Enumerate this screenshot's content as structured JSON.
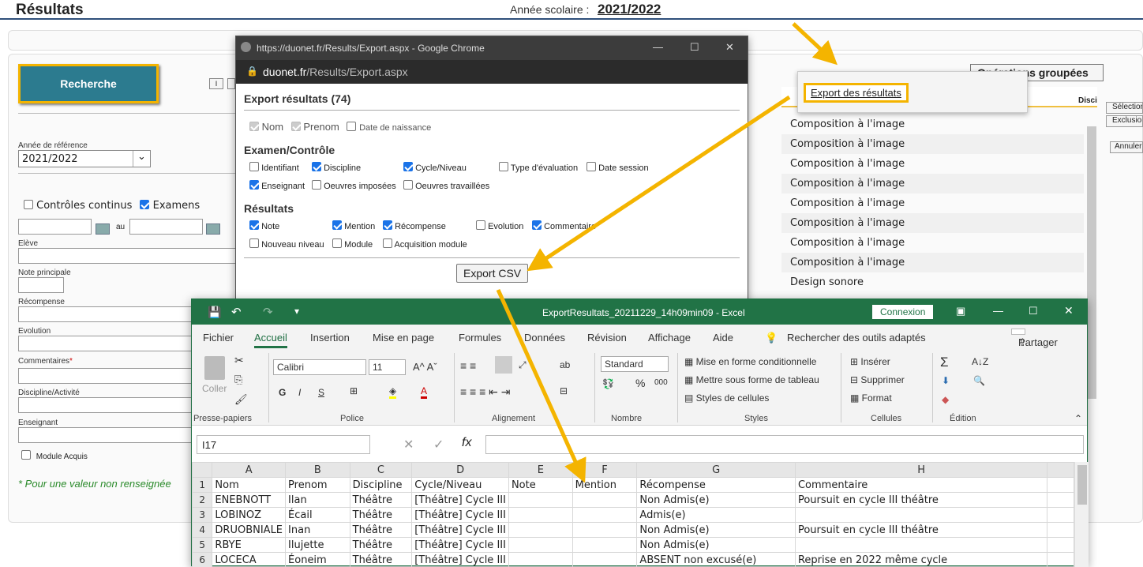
{
  "page": {
    "title": "Résultats",
    "year_label": "Année scolaire :",
    "year_value": "2021/2022"
  },
  "search": {
    "button": "Recherche",
    "ref_year_label": "Année de référence",
    "ref_year_value": "2021/2022",
    "controles_label": "Contrôles continus",
    "examens_label": "Examens",
    "au_label": "au",
    "eleve_label": "Elève",
    "note_label": "Note principale",
    "recompense_label": "Récompense",
    "evolution_label": "Evolution",
    "commentaires_label": "Commentaires",
    "commentaires_star": "*",
    "discipline_label": "Discipline/Activité",
    "enseignant_label": "Enseignant",
    "module_label": "Module Acquis",
    "footnote": "* Pour une valeur non renseignée"
  },
  "ops": {
    "grouped_label": "Opérations groupées",
    "export_link": "Export des résultats",
    "selection": "Sélection",
    "exclusion": "Exclusion",
    "annuler": "Annuler",
    "col_disc": "Disci"
  },
  "results_rows": [
    "Composition à l'image",
    "Composition à l'image",
    "Composition à l'image",
    "Composition à l'image",
    "Composition à l'image",
    "Composition à l'image",
    "Composition à l'image",
    "Composition à l'image",
    "Design sonore"
  ],
  "chrome": {
    "title": "https://duonet.fr/Results/Export.aspx - Google Chrome",
    "domain": "duonet.fr",
    "path": "/Results/Export.aspx",
    "heading": "Export résultats (74)",
    "nom": "Nom",
    "prenom": "Prenom",
    "naissance": "Date de naissance",
    "section_exam": "Examen/Contrôle",
    "identifiant": "Identifiant",
    "discipline": "Discipline",
    "cycle": "Cycle/Niveau",
    "type_eval": "Type d'évaluation",
    "date_session": "Date session",
    "enseignant": "Enseignant",
    "oeuvres_imposees": "Oeuvres imposées",
    "oeuvres_travaillees": "Oeuvres travaillées",
    "section_results": "Résultats",
    "note": "Note",
    "mention": "Mention",
    "recompense": "Récompense",
    "evolution": "Evolution",
    "commentaire": "Commentaire",
    "nouveau_niveau": "Nouveau niveau",
    "module": "Module",
    "acquisition": "Acquisition module",
    "export_button": "Export CSV"
  },
  "excel": {
    "title": "ExportResultats_20211229_14h09min09 - Excel",
    "connexion": "Connexion",
    "tabs": [
      "Fichier",
      "Accueil",
      "Insertion",
      "Mise en page",
      "Formules",
      "Données",
      "Révision",
      "Affichage",
      "Aide"
    ],
    "search_tools": "Rechercher des outils adaptés",
    "share": "Partager",
    "coller": "Coller",
    "font": "Calibri",
    "size": "11",
    "number_format": "Standard",
    "cond_format": "Mise en forme conditionnelle",
    "table_format": "Mettre sous forme de tableau",
    "cell_styles": "Styles de cellules",
    "inserer": "Insérer",
    "supprimer": "Supprimer",
    "format": "Format",
    "groups": [
      "Presse-papiers",
      "Police",
      "Alignement",
      "Nombre",
      "Styles",
      "Cellules",
      "Édition"
    ],
    "cell_ref": "I17",
    "fx": "fx",
    "columns": [
      "A",
      "B",
      "C",
      "D",
      "E",
      "F",
      "G",
      "H"
    ],
    "rows": [
      [
        "1",
        "Nom",
        "Prenom",
        "Discipline",
        "Cycle/Niveau",
        "Note",
        "Mention",
        "Récompense",
        "Commentaire"
      ],
      [
        "2",
        "ENEBNOTT",
        "Ilan",
        "Théâtre",
        "[Théâtre] Cycle III",
        "",
        "",
        "Non Admis(e)",
        "Poursuit en cycle III théâtre"
      ],
      [
        "3",
        "LOBINOZ",
        "Écail",
        "Théâtre",
        "[Théâtre] Cycle III",
        "",
        "",
        "Admis(e)",
        ""
      ],
      [
        "4",
        "DRUOBNIALE",
        "Inan",
        "Théâtre",
        "[Théâtre] Cycle III",
        "",
        "",
        "Non Admis(e)",
        "Poursuit en cycle III théâtre"
      ],
      [
        "5",
        "RBYE",
        "Ilujette",
        "Théâtre",
        "[Théâtre] Cycle III",
        "",
        "",
        "Non Admis(e)",
        ""
      ],
      [
        "6",
        "LOCECA",
        "Éoneim",
        "Théâtre",
        "[Théâtre] Cycle III",
        "",
        "",
        "ABSENT non excusé(e)",
        "Reprise en 2022 même cycle"
      ]
    ]
  },
  "colors": {
    "accent": "#f4b400",
    "excel_green": "#217346",
    "teal": "#2c7b8f"
  }
}
